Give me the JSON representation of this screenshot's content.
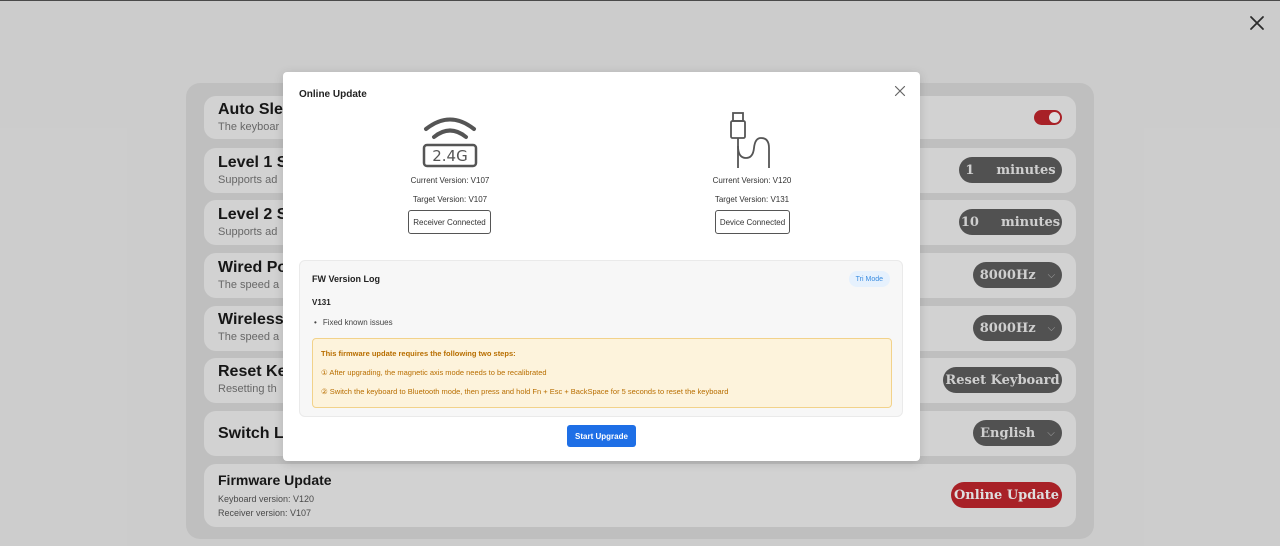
{
  "settings": {
    "rows": [
      {
        "title": "Auto Sle",
        "desc": "The keyboar"
      },
      {
        "title": "Level 1 S",
        "desc": "Supports ad"
      },
      {
        "title": "Level 2 S",
        "desc": "Supports ad"
      },
      {
        "title": "Wired Po",
        "desc": "The speed a"
      },
      {
        "title": "Wireless",
        "desc": "The speed a"
      },
      {
        "title": "Reset Ke",
        "desc": "Resetting th"
      },
      {
        "title": "Switch La",
        "desc": ""
      }
    ],
    "level1_value": "1",
    "level1_unit": "minutes",
    "level2_value": "10",
    "level2_unit": "minutes",
    "wired_polling": "8000Hz",
    "wireless_polling": "8000Hz",
    "reset_label": "Reset Keyboard",
    "language": "English",
    "auto_sleep_on": true,
    "firmware": {
      "title": "Firmware Update",
      "keyboard_version": "Keyboard version: V120",
      "receiver_version": "Receiver version: V107",
      "button_label": "Online Update"
    }
  },
  "modal": {
    "title": "Online Update",
    "receiver": {
      "icon_label": "2.4G",
      "current_version": "Current Version: V107",
      "target_version": "Target Version: V107",
      "status": "Receiver Connected"
    },
    "device": {
      "current_version": "Current Version: V120",
      "target_version": "Target Version: V131",
      "status": "Device Connected"
    },
    "log": {
      "title": "FW Version Log",
      "badge": "Tri Mode",
      "version": "V131",
      "items": [
        "Fixed known issues"
      ],
      "warning_title": "This firmware update requires the following two steps:",
      "warning_steps": [
        "① After upgrading, the magnetic axis mode needs to be recalibrated",
        "② Switch the keyboard to Bluetooth mode, then press and hold Fn + Esc + BackSpace for 5 seconds to reset the keyboard"
      ]
    },
    "start_label": "Start Upgrade"
  },
  "colors": {
    "accent_red": "#c2272d",
    "primary_blue": "#1e6fe6",
    "warning_text": "#b86e00"
  }
}
